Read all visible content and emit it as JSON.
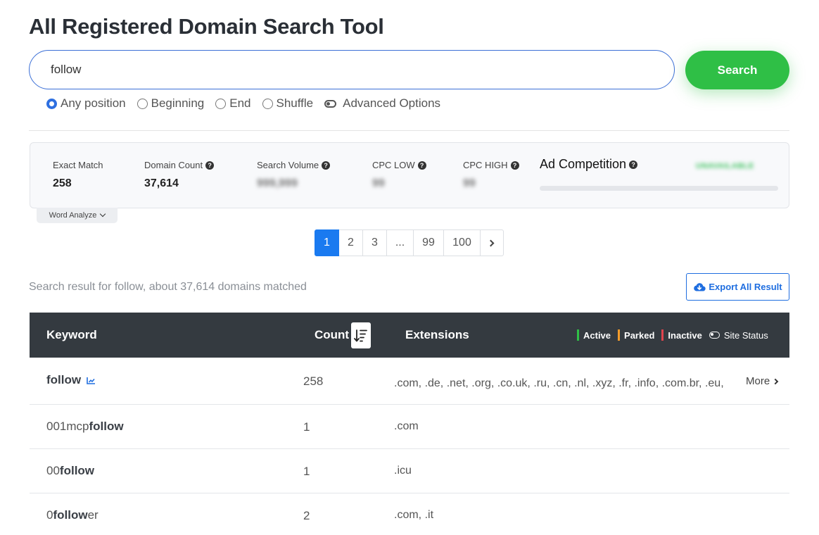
{
  "header": {
    "title": "All Registered Domain Search Tool"
  },
  "search": {
    "value": "follow",
    "button_label": "Search"
  },
  "options": {
    "positions": [
      {
        "label": "Any position",
        "checked": true
      },
      {
        "label": "Beginning",
        "checked": false
      },
      {
        "label": "End",
        "checked": false
      },
      {
        "label": "Shuffle",
        "checked": false
      }
    ],
    "advanced_label": "Advanced Options"
  },
  "stats": {
    "exact_match": {
      "label": "Exact Match",
      "value": "258"
    },
    "domain_count": {
      "label": "Domain Count",
      "value": "37,614"
    },
    "search_volume": {
      "label": "Search Volume",
      "value": "999,999"
    },
    "cpc_low": {
      "label": "CPC LOW",
      "value": "99"
    },
    "cpc_high": {
      "label": "CPC HIGH",
      "value": "99"
    },
    "ad_competition": {
      "label": "Ad Competition",
      "value": "UNAVAILABLE"
    },
    "word_analyze_label": "Word Analyze"
  },
  "pagination": {
    "pages": [
      "1",
      "2",
      "3",
      "...",
      "99",
      "100"
    ],
    "active": "1"
  },
  "results": {
    "summary": "Search result for follow, about 37,614 domains matched",
    "export_label": "Export All Result"
  },
  "table": {
    "headers": {
      "keyword": "Keyword",
      "count": "Count",
      "extensions": "Extensions"
    },
    "legend": {
      "active": "Active",
      "parked": "Parked",
      "inactive": "Inactive",
      "site_status": "Site Status",
      "colors": {
        "active": "#2fbf46",
        "parked": "#f39c2b",
        "inactive": "#e0434d"
      }
    },
    "rows": [
      {
        "kw_pre": "",
        "kw_match": "follow",
        "kw_post": "",
        "count": "258",
        "extensions": ".com, .de, .net, .org, .co.uk, .ru, .cn, .nl, .xyz, .fr, .info, .com.br, .eu,",
        "more_label": "More"
      },
      {
        "kw_pre": "001mcp",
        "kw_match": "follow",
        "kw_post": "",
        "count": "1",
        "extensions": ".com"
      },
      {
        "kw_pre": "00",
        "kw_match": "follow",
        "kw_post": "",
        "count": "1",
        "extensions": ".icu"
      },
      {
        "kw_pre": "0",
        "kw_match": "follow",
        "kw_post": "er",
        "count": "2",
        "extensions": ".com, .it"
      }
    ]
  },
  "colors": {
    "accent": "#1a7af0",
    "search_button": "#2fbf46",
    "header_bg": "#343a40"
  }
}
